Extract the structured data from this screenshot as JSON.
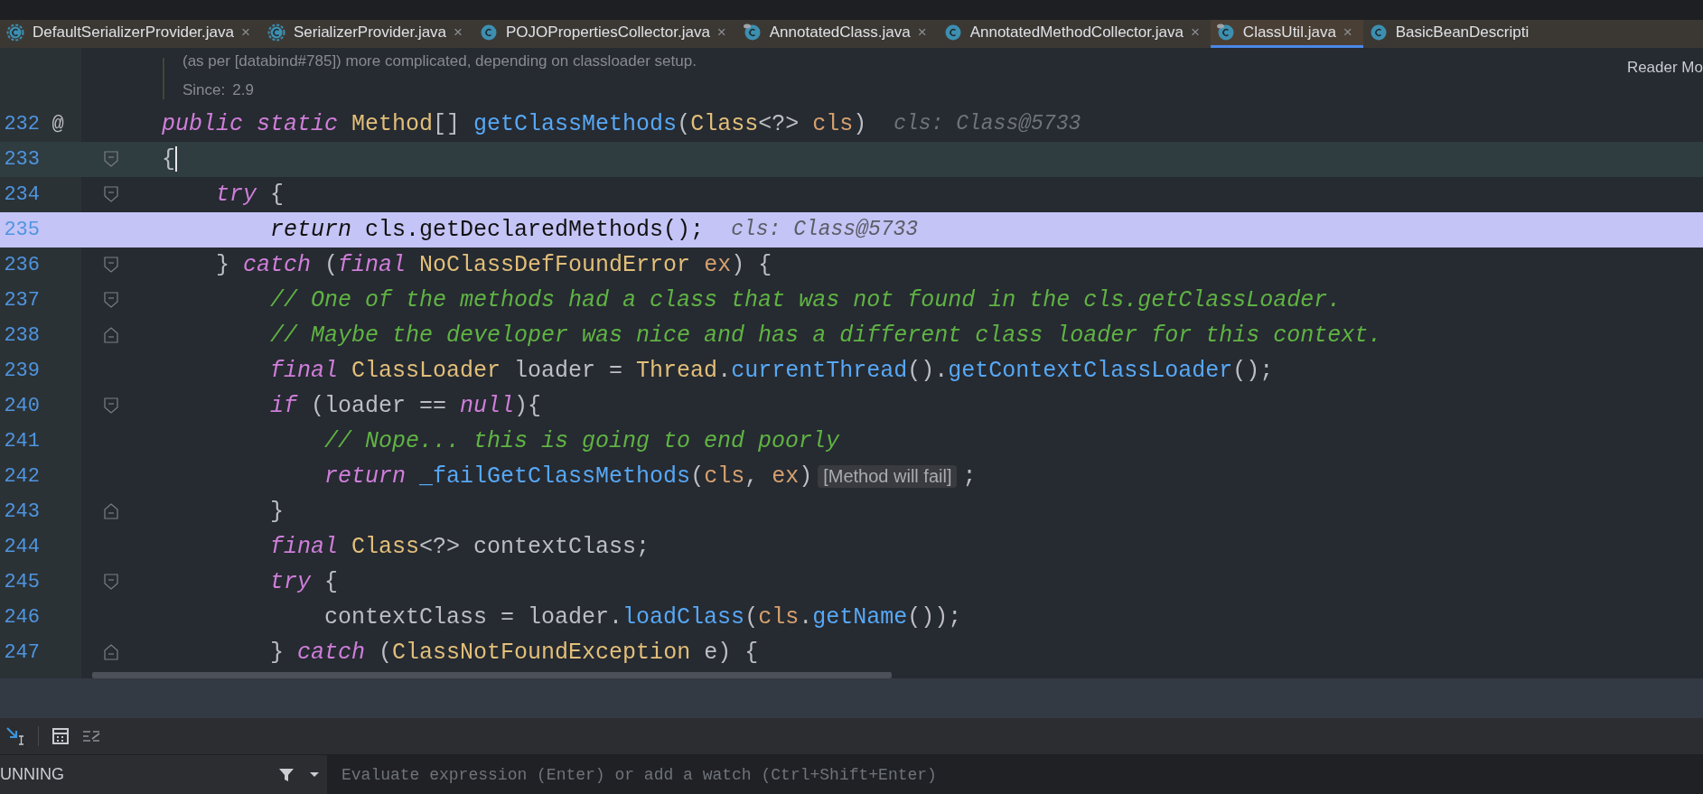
{
  "tabs": [
    {
      "label": "DefaultSerializerProvider.java",
      "kind": "abstract",
      "pinned": false,
      "selected": false,
      "close": "×"
    },
    {
      "label": "SerializerProvider.java",
      "kind": "abstract",
      "pinned": false,
      "selected": false,
      "close": "×"
    },
    {
      "label": "POJOPropertiesCollector.java",
      "kind": "class",
      "pinned": false,
      "selected": false,
      "close": "×"
    },
    {
      "label": "AnnotatedClass.java",
      "kind": "class",
      "pinned": true,
      "selected": false,
      "close": "×"
    },
    {
      "label": "AnnotatedMethodCollector.java",
      "kind": "class",
      "pinned": false,
      "selected": false,
      "close": "×"
    },
    {
      "label": "ClassUtil.java",
      "kind": "class",
      "pinned": true,
      "selected": true,
      "close": "×"
    },
    {
      "label": "BasicBeanDescripti",
      "kind": "class",
      "pinned": false,
      "selected": false
    }
  ],
  "reader_mode": "Reader Mo",
  "doc": {
    "text": "(as per [databind#785]) more complicated, depending on classloader setup.",
    "since_label": "Since:",
    "since_value": "2.9"
  },
  "lines": [
    {
      "number": "232",
      "gutter_mark": "@",
      "caret": false,
      "current": false,
      "tokens": [
        {
          "kind": "kw",
          "text": "public static "
        },
        {
          "kind": "type",
          "text": "Method"
        },
        {
          "kind": "plain",
          "text": "[] "
        },
        {
          "kind": "fn",
          "text": "getClassMethods"
        },
        {
          "kind": "plain",
          "text": "("
        },
        {
          "kind": "type",
          "text": "Class"
        },
        {
          "kind": "plain",
          "text": "<?> "
        },
        {
          "kind": "param",
          "text": "cls"
        },
        {
          "kind": "plain",
          "text": ")"
        },
        {
          "kind": "hint",
          "text": "cls: Class@5733"
        }
      ]
    },
    {
      "number": "233",
      "fold": {
        "kind": "start"
      },
      "caret": true,
      "current": false,
      "tokens": [
        {
          "kind": "plain",
          "text": "{"
        }
      ]
    },
    {
      "number": "234",
      "fold": {
        "kind": "start"
      },
      "caret": false,
      "current": false,
      "tokens": [
        {
          "kind": "kw",
          "text": "    try"
        },
        {
          "kind": "plain",
          "text": " {"
        }
      ]
    },
    {
      "number": "235",
      "caret": false,
      "current": true,
      "tokens": [
        {
          "kind": "kw",
          "text": "        return"
        },
        {
          "kind": "plain",
          "text": " cls.getDeclaredMethods();"
        },
        {
          "kind": "hint",
          "text": "cls: Class@5733"
        }
      ]
    },
    {
      "number": "236",
      "fold": {
        "kind": "start"
      },
      "caret": false,
      "current": false,
      "tokens": [
        {
          "kind": "plain",
          "text": "    } "
        },
        {
          "kind": "kw",
          "text": "catch"
        },
        {
          "kind": "plain",
          "text": " ("
        },
        {
          "kind": "kw",
          "text": "final "
        },
        {
          "kind": "type",
          "text": "NoClassDefFoundError "
        },
        {
          "kind": "param",
          "text": "ex"
        },
        {
          "kind": "plain",
          "text": ") {"
        }
      ]
    },
    {
      "number": "237",
      "fold": {
        "kind": "start"
      },
      "caret": false,
      "current": false,
      "tokens": [
        {
          "kind": "comment",
          "text": "        // One of the methods had a class that was not found in the cls.getClassLoader."
        }
      ]
    },
    {
      "number": "238",
      "fold": {
        "kind": "end"
      },
      "caret": false,
      "current": false,
      "tokens": [
        {
          "kind": "comment",
          "text": "        // Maybe the developer was nice and has a different class loader for this context."
        }
      ]
    },
    {
      "number": "239",
      "caret": false,
      "current": false,
      "tokens": [
        {
          "kind": "kw",
          "text": "        final "
        },
        {
          "kind": "type",
          "text": "ClassLoader"
        },
        {
          "kind": "plain",
          "text": " loader = "
        },
        {
          "kind": "type",
          "text": "Thread"
        },
        {
          "kind": "plain",
          "text": "."
        },
        {
          "kind": "fn",
          "text": "currentThread"
        },
        {
          "kind": "plain",
          "text": "()."
        },
        {
          "kind": "fn",
          "text": "getContextClassLoader"
        },
        {
          "kind": "plain",
          "text": "();"
        }
      ]
    },
    {
      "number": "240",
      "fold": {
        "kind": "start"
      },
      "caret": false,
      "current": false,
      "tokens": [
        {
          "kind": "kw",
          "text": "        if"
        },
        {
          "kind": "plain",
          "text": " (loader == "
        },
        {
          "kind": "kw",
          "text": "null"
        },
        {
          "kind": "plain",
          "text": "){"
        }
      ]
    },
    {
      "number": "241",
      "caret": false,
      "current": false,
      "tokens": [
        {
          "kind": "comment",
          "text": "            // Nope... this is going to end poorly"
        }
      ]
    },
    {
      "number": "242",
      "caret": false,
      "current": false,
      "tokens": [
        {
          "kind": "kw",
          "text": "            return "
        },
        {
          "kind": "fn",
          "text": "_failGetClassMethods"
        },
        {
          "kind": "plain",
          "text": "("
        },
        {
          "kind": "param",
          "text": "cls"
        },
        {
          "kind": "plain",
          "text": ", "
        },
        {
          "kind": "param",
          "text": "ex"
        },
        {
          "kind": "plain",
          "text": ")"
        },
        {
          "kind": "inlay",
          "text": "[Method will fail]"
        },
        {
          "kind": "plain",
          "text": ";"
        }
      ]
    },
    {
      "number": "243",
      "fold": {
        "kind": "end"
      },
      "caret": false,
      "current": false,
      "tokens": [
        {
          "kind": "plain",
          "text": "        }"
        }
      ]
    },
    {
      "number": "244",
      "caret": false,
      "current": false,
      "tokens": [
        {
          "kind": "kw",
          "text": "        final "
        },
        {
          "kind": "type",
          "text": "Class"
        },
        {
          "kind": "plain",
          "text": "<?> contextClass;"
        }
      ]
    },
    {
      "number": "245",
      "fold": {
        "kind": "start"
      },
      "caret": false,
      "current": false,
      "tokens": [
        {
          "kind": "kw",
          "text": "        try"
        },
        {
          "kind": "plain",
          "text": " {"
        }
      ]
    },
    {
      "number": "246",
      "caret": false,
      "current": false,
      "tokens": [
        {
          "kind": "plain",
          "text": "            contextClass = loader."
        },
        {
          "kind": "fn",
          "text": "loadClass"
        },
        {
          "kind": "plain",
          "text": "("
        },
        {
          "kind": "param",
          "text": "cls"
        },
        {
          "kind": "plain",
          "text": "."
        },
        {
          "kind": "fn",
          "text": "getName"
        },
        {
          "kind": "plain",
          "text": "());"
        }
      ]
    },
    {
      "number": "247",
      "fold": {
        "kind": "end"
      },
      "caret": false,
      "current": false,
      "tokens": [
        {
          "kind": "plain",
          "text": "        } "
        },
        {
          "kind": "kw",
          "text": "catch"
        },
        {
          "kind": "plain",
          "text": " ("
        },
        {
          "kind": "type",
          "text": "ClassNotFoundException"
        },
        {
          "kind": "plain",
          "text": " e) {"
        }
      ]
    }
  ],
  "debug": {
    "status": "UNNING",
    "placeholder": "Evaluate expression (Enter) or add a watch (Ctrl+Shift+Enter)"
  }
}
